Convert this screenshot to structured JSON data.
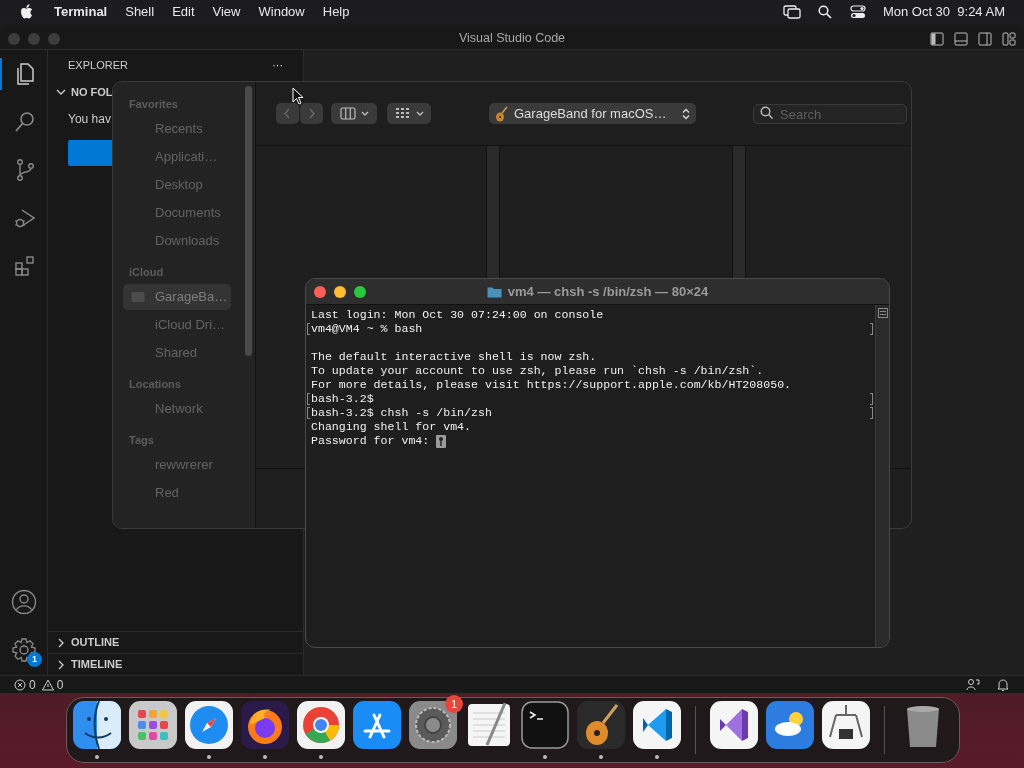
{
  "menu_bar": {
    "app": "Terminal",
    "menus": [
      "Shell",
      "Edit",
      "View",
      "Window",
      "Help"
    ],
    "clock": "Mon Oct 30  9:24 AM"
  },
  "vscode": {
    "title": "Visual Studio Code",
    "activity": [
      {
        "kind": "files",
        "selected": true
      },
      {
        "kind": "search",
        "selected": false
      },
      {
        "kind": "scm",
        "selected": false
      },
      {
        "kind": "debug",
        "selected": false
      },
      {
        "kind": "extensions",
        "selected": false
      }
    ],
    "settings_badge": "1",
    "sidebar": {
      "title": "EXPLORER",
      "more": "···",
      "section": "NO FOL",
      "message": "You hav"
    },
    "panels": [
      {
        "label": "OUTLINE",
        "expanded": false
      },
      {
        "label": "TIMELINE",
        "expanded": false
      }
    ],
    "status": {
      "errors": "0",
      "warnings": "0"
    }
  },
  "finder": {
    "sections": [
      {
        "heading": "Favorites",
        "items": [
          {
            "label": "Recents",
            "selected": false
          },
          {
            "label": "Applicati…",
            "selected": false
          },
          {
            "label": "Desktop",
            "selected": false
          },
          {
            "label": "Documents",
            "selected": false
          },
          {
            "label": "Downloads",
            "selected": false
          }
        ]
      },
      {
        "heading": "iCloud",
        "items": [
          {
            "label": "GarageBa…",
            "selected": true
          },
          {
            "label": "iCloud Dri…",
            "selected": false
          },
          {
            "label": "Shared",
            "selected": false
          }
        ]
      },
      {
        "heading": "Locations",
        "items": [
          {
            "label": "Network",
            "selected": false
          }
        ]
      },
      {
        "heading": "Tags",
        "items": [
          {
            "label": "rewwrerer",
            "selected": false
          },
          {
            "label": "Red",
            "selected": false
          }
        ]
      }
    ],
    "location": "GarageBand for macOS…",
    "search": {
      "placeholder": "Search"
    }
  },
  "terminal": {
    "title": "vm4 — chsh -s /bin/zsh — 80×24",
    "lines": [
      {
        "text": "Last login: Mon Oct 30 07:24:00 on console",
        "marked": false
      },
      {
        "text": "vm4@VM4 ~ % bash",
        "marked": true
      },
      {
        "marked": false
      },
      {
        "text": "The default interactive shell is now zsh.",
        "marked": false
      },
      {
        "text": "To update your account to use zsh, please run `chsh -s /bin/zsh`.",
        "marked": false
      },
      {
        "text": "For more details, please visit https://support.apple.com/kb/HT208050.",
        "marked": false
      },
      {
        "text": "bash-3.2$",
        "marked": true
      },
      {
        "text": "bash-3.2$ chsh -s /bin/zsh",
        "marked": true
      },
      {
        "text": "Changing shell for vm4.",
        "marked": false
      },
      {
        "text": "Password for vm4:",
        "marked": false,
        "key_cursor": true
      }
    ]
  },
  "dock": [
    {
      "kind": "finder",
      "running": true
    },
    {
      "kind": "launchpad",
      "running": false
    },
    {
      "kind": "safari",
      "running": true
    },
    {
      "kind": "firefox",
      "running": true
    },
    {
      "kind": "chrome",
      "running": true
    },
    {
      "kind": "appstore",
      "running": false
    },
    {
      "kind": "settings",
      "running": false,
      "badge": "1"
    },
    {
      "kind": "textedit",
      "running": false
    },
    {
      "kind": "terminal",
      "running": true
    },
    {
      "kind": "garageband",
      "running": true
    },
    {
      "kind": "vscode",
      "running": true
    },
    {
      "kind": "separator"
    },
    {
      "kind": "visualstudio",
      "running": false
    },
    {
      "kind": "weather",
      "running": false
    },
    {
      "kind": "sysinfo",
      "running": false
    },
    {
      "kind": "separator"
    },
    {
      "kind": "trash",
      "running": false
    }
  ]
}
